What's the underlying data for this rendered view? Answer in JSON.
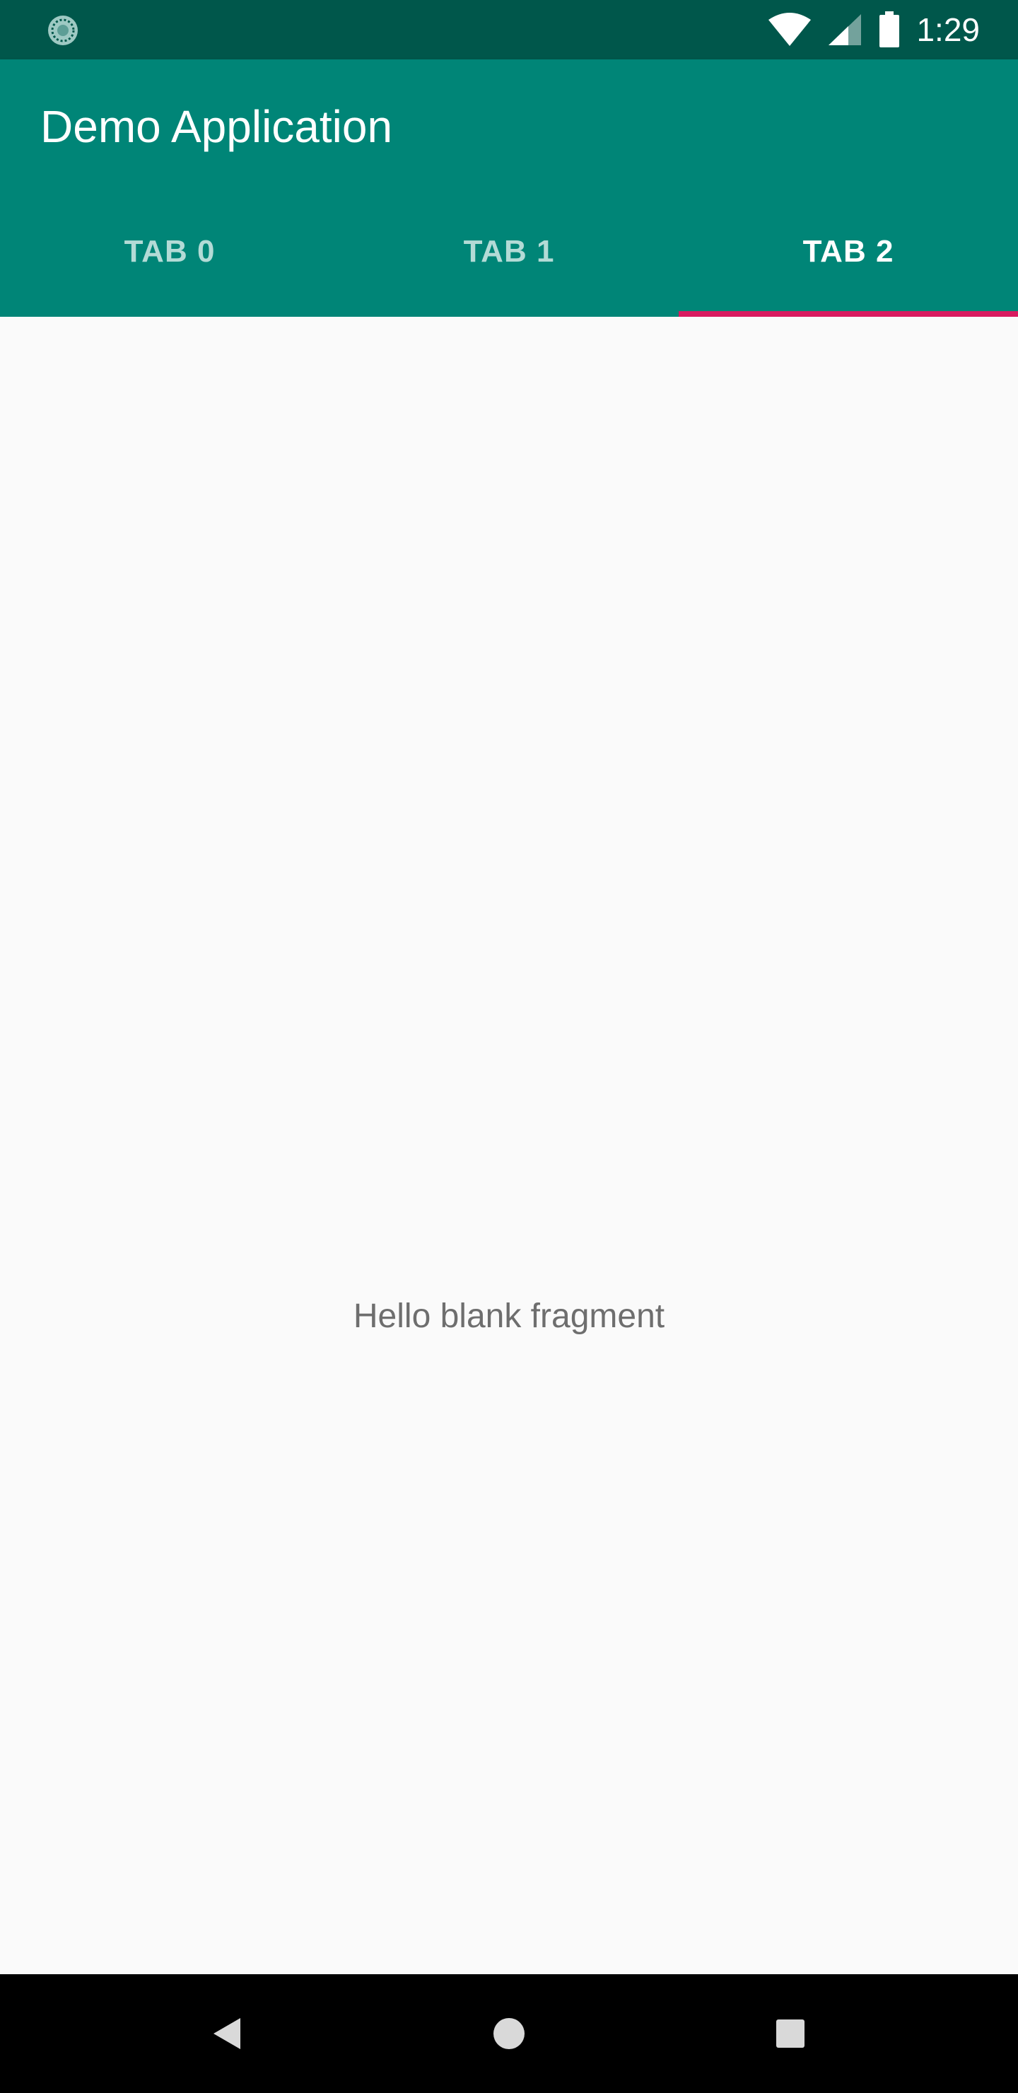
{
  "status_bar": {
    "time": "1:29",
    "left_icon": "sync-indicator-icon",
    "right_icons": [
      "wifi-icon",
      "cellular-signal-icon",
      "battery-icon"
    ],
    "background": "#00574b"
  },
  "app_bar": {
    "title": "Demo Application",
    "background": "#008577"
  },
  "tabs": {
    "items": [
      {
        "label": "TAB 0",
        "selected": false
      },
      {
        "label": "TAB 1",
        "selected": false
      },
      {
        "label": "TAB 2",
        "selected": true
      }
    ],
    "indicator_color": "#d81b60"
  },
  "content": {
    "text": "Hello blank fragment"
  },
  "nav_bar": {
    "buttons": [
      "back-icon",
      "home-icon",
      "recents-icon"
    ],
    "background": "#000000"
  }
}
